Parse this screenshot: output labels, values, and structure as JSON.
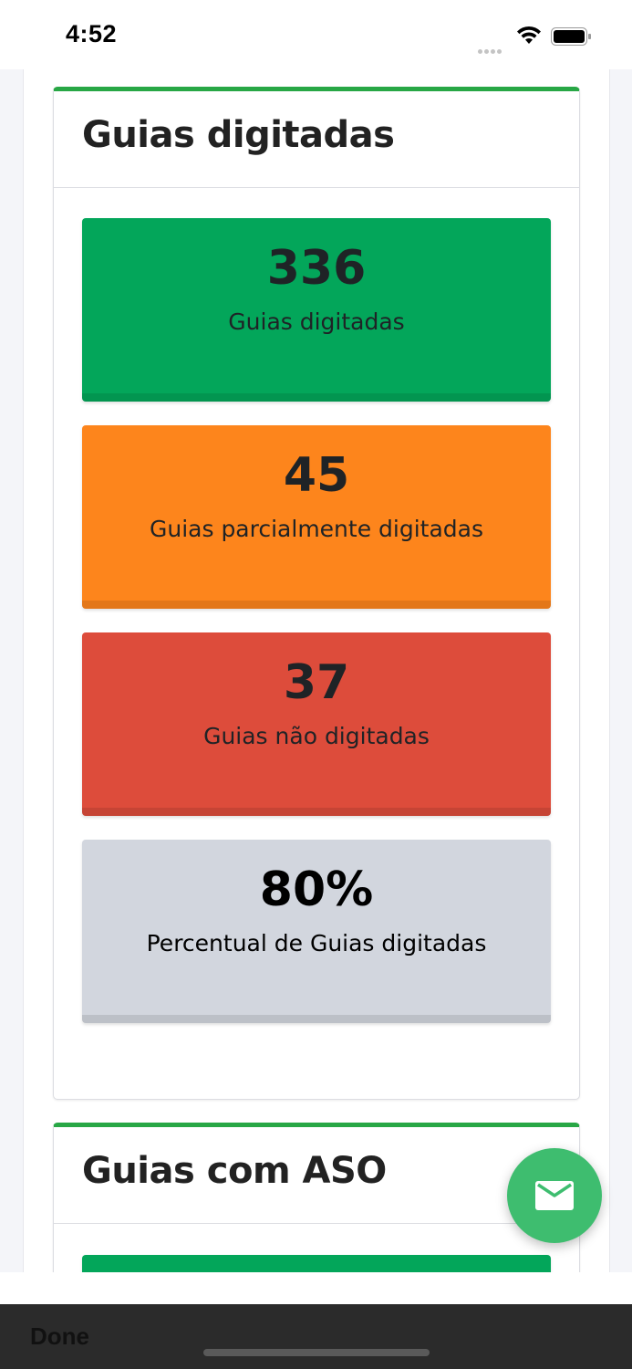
{
  "status_bar": {
    "time": "4:52"
  },
  "cards": [
    {
      "title": "Guias digitadas",
      "stats": [
        {
          "value": "336",
          "label": "Guias digitadas",
          "color": "#03a65a"
        },
        {
          "value": "45",
          "label": "Guias parcialmente digitadas",
          "color": "#fd851c"
        },
        {
          "value": "37",
          "label": "Guias não digitadas",
          "color": "#dd4c3b"
        },
        {
          "value": "80%",
          "label": "Percentual de Guias digitadas",
          "color": "#d2d6de"
        }
      ]
    },
    {
      "title": "Guias com ASO",
      "stats": [
        {
          "color": "#03a65a"
        }
      ]
    }
  ],
  "fab": {
    "icon": "mail-icon",
    "color": "#3ebd6f"
  },
  "bottom_bar": {
    "done_label": "Done"
  },
  "colors": {
    "card_accent": "#28a745",
    "page_bg": "#f4f5f9"
  }
}
